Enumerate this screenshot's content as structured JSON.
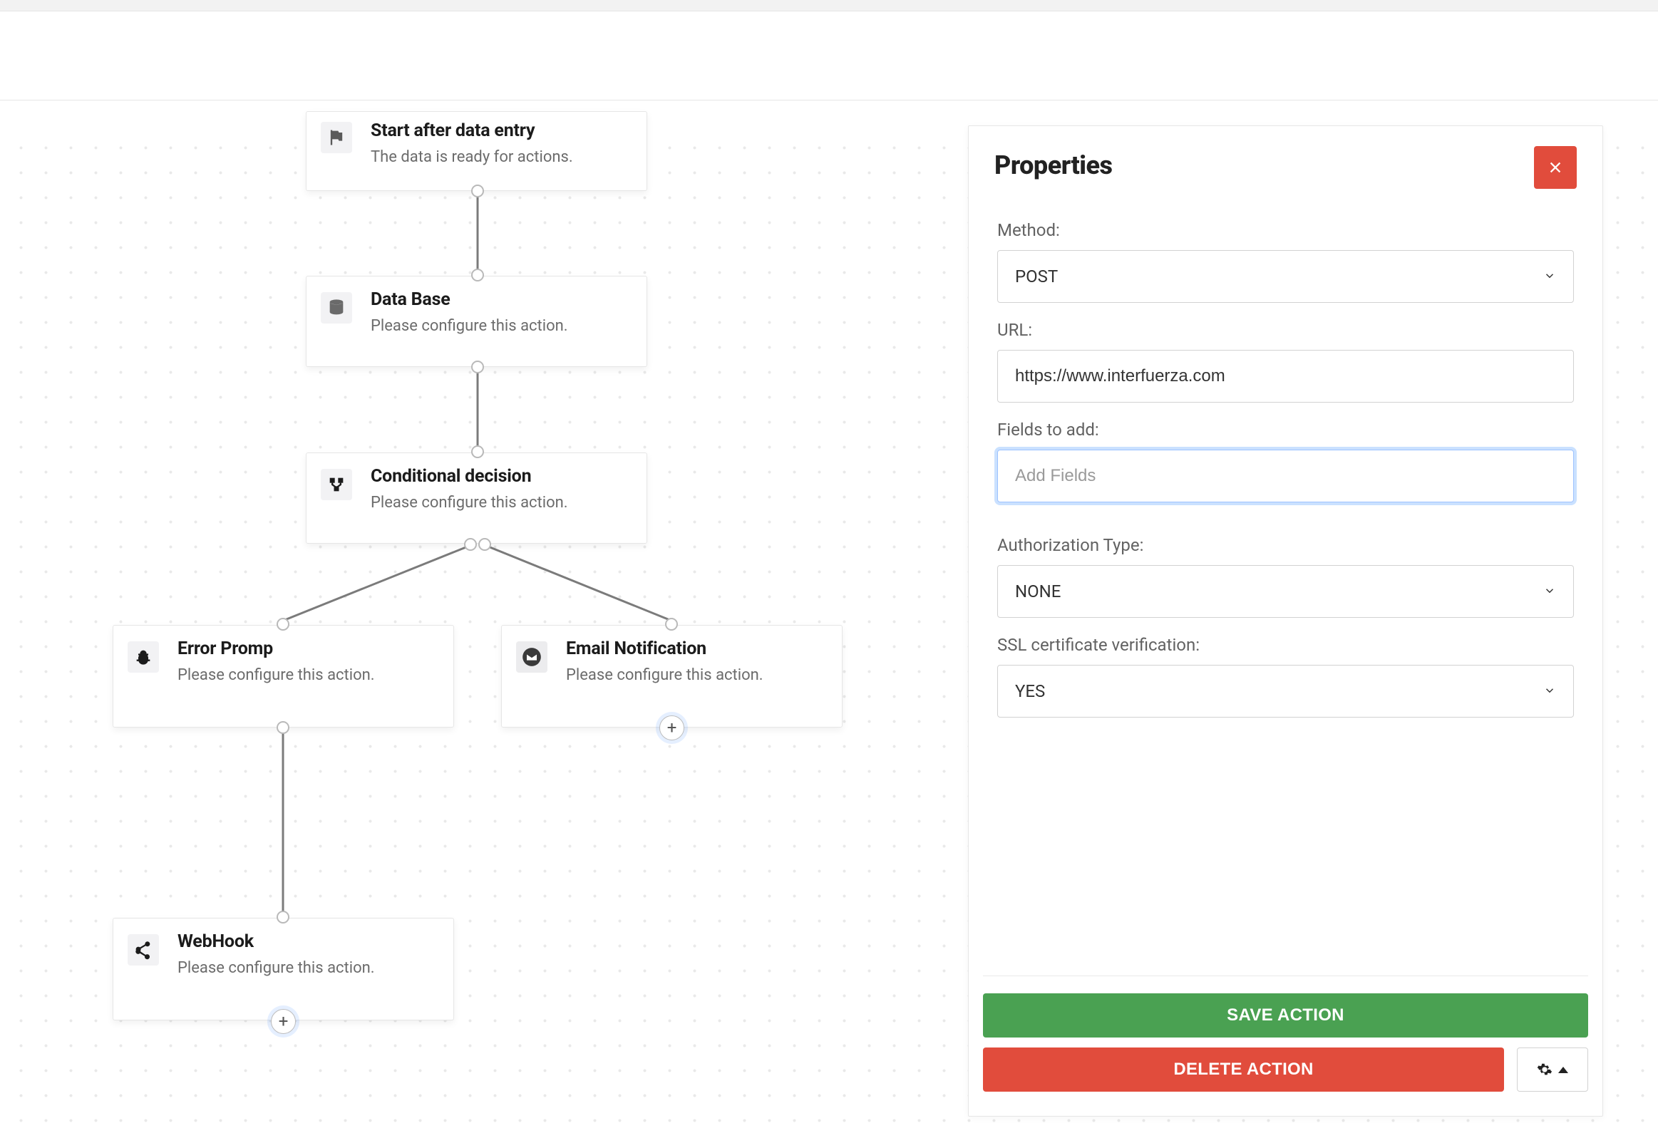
{
  "panel": {
    "title": "Properties",
    "method_label": "Method:",
    "method_value": "POST",
    "url_label": "URL:",
    "url_value": "https://www.interfuerza.com",
    "fields_label": "Fields to add:",
    "fields_placeholder": "Add Fields",
    "auth_label": "Authorization Type:",
    "auth_value": "NONE",
    "ssl_label": "SSL certificate verification:",
    "ssl_value": "YES",
    "save_label": "SAVE ACTION",
    "delete_label": "DELETE ACTION"
  },
  "nodes": {
    "start": {
      "title": "Start after data entry",
      "sub": "The data is ready for actions."
    },
    "database": {
      "title": "Data Base",
      "sub": "Please configure this action."
    },
    "conditional": {
      "title": "Conditional decision",
      "sub": "Please configure this action."
    },
    "error": {
      "title": "Error Promp",
      "sub": "Please configure this action."
    },
    "email": {
      "title": "Email Notification",
      "sub": "Please configure this action."
    },
    "webhook": {
      "title": "WebHook",
      "sub": "Please configure this action."
    }
  },
  "colors": {
    "accent_red": "#e14c3c",
    "accent_green": "#4aa152",
    "focus_blue": "#9ec3ff"
  }
}
